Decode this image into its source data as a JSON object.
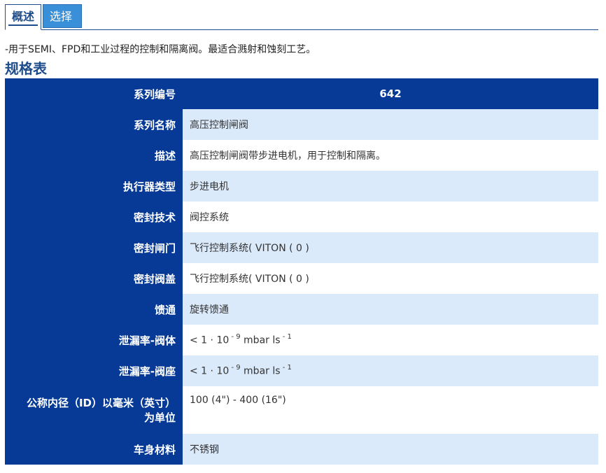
{
  "tabs": [
    {
      "label": "概述",
      "active": true
    },
    {
      "label": "选择",
      "active": false
    }
  ],
  "intro_text": "-用于SEMI、FPD和工业过程的控制和隔离阀。最适合溅射和蚀刻工艺。",
  "section_title": "规格表",
  "spec": {
    "header": {
      "label": "系列编号",
      "value": "642"
    },
    "rows": [
      {
        "label": "系列名称",
        "value": "高压控制闸阀"
      },
      {
        "label": "描述",
        "value": "高压控制闸阀带步进电机，用于控制和隔离。"
      },
      {
        "label": "执行器类型",
        "value": "步进电机"
      },
      {
        "label": "密封技术",
        "value": "阀控系统"
      },
      {
        "label": "密封闸门",
        "value": "飞行控制系统( VITON ( 0 )"
      },
      {
        "label": "密封阀盖",
        "value": "飞行控制系统( VITON ( 0 )"
      },
      {
        "label": "馈通",
        "value": "旋转馈通"
      },
      {
        "label": "泄漏率-阀体",
        "value_prefix": "< 1 · 10",
        "exp1": " - 9",
        "value_mid": " mbar ls",
        "exp2": " - 1"
      },
      {
        "label": "泄漏率-阀座",
        "value_prefix": "< 1 · 10",
        "exp1": " - 9",
        "value_mid": " mbar ls",
        "exp2": " - 1"
      },
      {
        "label_line1": "公称内径（ID）以毫米（英寸）",
        "label_line2": "为单位",
        "value": "100 (4\") - 400 (16\")"
      },
      {
        "label": "车身材料",
        "value": "不锈钢"
      }
    ]
  },
  "colors": {
    "header_bg": "#063a96",
    "row_alt_bg": "#dbeafb",
    "tab_inactive_bg": "#3a8fd9",
    "title_color": "#1f4d8c"
  }
}
